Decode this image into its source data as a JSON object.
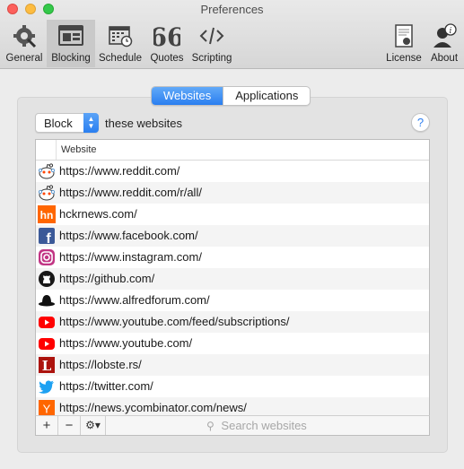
{
  "window": {
    "title": "Preferences"
  },
  "toolbar": {
    "items": [
      {
        "label": "General",
        "icon": "gear-wrench-icon"
      },
      {
        "label": "Blocking",
        "icon": "browser-window-icon"
      },
      {
        "label": "Schedule",
        "icon": "calendar-icon"
      },
      {
        "label": "Quotes",
        "icon": "quote-icon"
      },
      {
        "label": "Scripting",
        "icon": "code-icon"
      },
      {
        "label": "License",
        "icon": "certificate-icon"
      },
      {
        "label": "About",
        "icon": "person-info-icon"
      }
    ],
    "selected": "Blocking"
  },
  "tabs": {
    "websites": "Websites",
    "applications": "Applications",
    "active": "Websites"
  },
  "block_mode": {
    "value": "Block",
    "suffix": "these websites",
    "help": "?"
  },
  "table": {
    "header": "Website",
    "rows": [
      {
        "url": "https://www.reddit.com/",
        "icon": "reddit-icon"
      },
      {
        "url": "https://www.reddit.com/r/all/",
        "icon": "reddit-icon"
      },
      {
        "url": "hckrnews.com/",
        "icon": "hn-icon"
      },
      {
        "url": "https://www.facebook.com/",
        "icon": "facebook-icon"
      },
      {
        "url": "https://www.instagram.com/",
        "icon": "instagram-icon"
      },
      {
        "url": "https://github.com/",
        "icon": "github-icon"
      },
      {
        "url": "https://www.alfredforum.com/",
        "icon": "bowler-hat-icon"
      },
      {
        "url": "https://www.youtube.com/feed/subscriptions/",
        "icon": "youtube-icon"
      },
      {
        "url": "https://www.youtube.com/",
        "icon": "youtube-icon"
      },
      {
        "url": "https://lobste.rs/",
        "icon": "lobsters-icon"
      },
      {
        "url": "https://twitter.com/",
        "icon": "twitter-icon"
      },
      {
        "url": "https://news.ycombinator.com/news/",
        "icon": "ycombinator-icon"
      }
    ]
  },
  "bottom": {
    "add": "+",
    "remove": "−",
    "gear": "⚙▾",
    "search_placeholder": "Search websites"
  },
  "colors": {
    "accent": "#2a7ef0",
    "selected_toolbar": "#c9c9c9"
  }
}
